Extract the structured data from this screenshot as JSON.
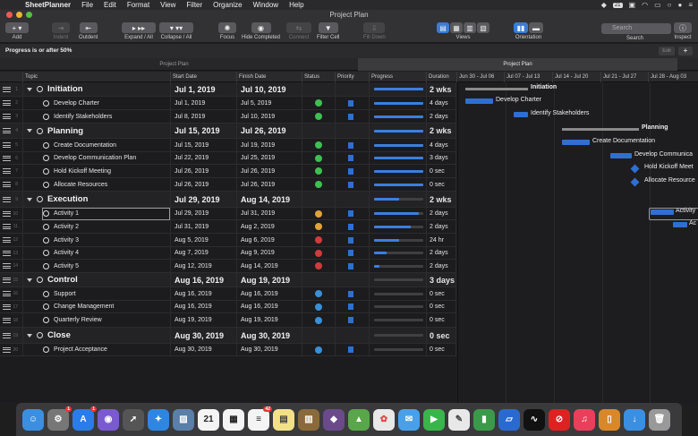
{
  "menubar": {
    "items": [
      "SheetPlanner",
      "File",
      "Edit",
      "Format",
      "View",
      "Filter",
      "Organize",
      "Window",
      "Help"
    ],
    "badge": "21"
  },
  "window": {
    "title": "Project Plan"
  },
  "toolbar": {
    "add": "Add",
    "indent": "Indent",
    "outdent": "Outdent",
    "expand": "Expand / All",
    "collapse": "Collapse / All",
    "focus": "Focus",
    "hide_completed": "Hide Completed",
    "connect": "Connect",
    "filter_cell": "Filter Cell",
    "fill_down": "Fill Down",
    "views": "Views",
    "orientation": "Orientation",
    "search_placeholder": "Search",
    "search_label": "Search",
    "inspect": "Inspect"
  },
  "filterbar": {
    "text": "Progress is or after 50%",
    "edit": "Edit",
    "plus": "+"
  },
  "tabs": {
    "left": "Project Plan",
    "right": "Project Plan"
  },
  "columns": {
    "topic": "Topic",
    "start": "Start Date",
    "finish": "Finish Date",
    "status": "Status",
    "priority": "Priority",
    "progress": "Progress",
    "duration": "Duration"
  },
  "gantt_weeks": [
    "Jun 30 - Jul 06",
    "Jul 07 - Jul 13",
    "Jul 14 - Jul 20",
    "Jul 21 - Jul 27",
    "Jul 28 - Aug 03"
  ],
  "rows": [
    {
      "n": "1",
      "group": true,
      "topic": "Initiation",
      "start": "Jul 1, 2019",
      "finish": "Jul 10, 2019",
      "status": "",
      "progress": 1.0,
      "duration": "2 wks"
    },
    {
      "n": "2",
      "group": false,
      "topic": "Develop Charter",
      "start": "Jul 1, 2019",
      "finish": "Jul 5, 2019",
      "status": "#3fbf52",
      "progress": 1.0,
      "duration": "4 days"
    },
    {
      "n": "3",
      "group": false,
      "topic": "Identify Stakeholders",
      "start": "Jul 8, 2019",
      "finish": "Jul 10, 2019",
      "status": "#3fbf52",
      "progress": 1.0,
      "duration": "2 days"
    },
    {
      "n": "4",
      "group": true,
      "topic": "Planning",
      "start": "Jul 15, 2019",
      "finish": "Jul 26, 2019",
      "status": "",
      "progress": 1.0,
      "duration": "2 wks"
    },
    {
      "n": "5",
      "group": false,
      "topic": "Create Documentation",
      "start": "Jul 15, 2019",
      "finish": "Jul 19, 2019",
      "status": "#3fbf52",
      "progress": 1.0,
      "duration": "4 days"
    },
    {
      "n": "6",
      "group": false,
      "topic": "Develop Communication Plan",
      "start": "Jul 22, 2019",
      "finish": "Jul 25, 2019",
      "status": "#3fbf52",
      "progress": 1.0,
      "duration": "3 days"
    },
    {
      "n": "7",
      "group": false,
      "topic": "Hold Kickoff Meeting",
      "start": "Jul 26, 2019",
      "finish": "Jul 26, 2019",
      "status": "#3fbf52",
      "progress": 1.0,
      "duration": "0 sec"
    },
    {
      "n": "8",
      "group": false,
      "topic": "Allocate Resources",
      "start": "Jul 26, 2019",
      "finish": "Jul 26, 2019",
      "status": "#3fbf52",
      "progress": 1.0,
      "duration": "0 sec"
    },
    {
      "n": "9",
      "group": true,
      "topic": "Execution",
      "start": "Jul 29, 2019",
      "finish": "Aug 14, 2019",
      "status": "",
      "progress": 0.5,
      "duration": "2 wks"
    },
    {
      "n": "10",
      "group": false,
      "topic": "Activity 1",
      "start": "Jul 29, 2019",
      "finish": "Jul 31, 2019",
      "status": "#e0a33a",
      "progress": 0.9,
      "duration": "2 days"
    },
    {
      "n": "11",
      "group": false,
      "topic": "Activity 2",
      "start": "Jul 31, 2019",
      "finish": "Aug 2, 2019",
      "status": "#e0a33a",
      "progress": 0.75,
      "duration": "2 days"
    },
    {
      "n": "12",
      "group": false,
      "topic": "Activity 3",
      "start": "Aug 5, 2019",
      "finish": "Aug 6, 2019",
      "status": "#d13b3b",
      "progress": 0.5,
      "duration": "24 hr"
    },
    {
      "n": "13",
      "group": false,
      "topic": "Activity 4",
      "start": "Aug 7, 2019",
      "finish": "Aug 9, 2019",
      "status": "#d13b3b",
      "progress": 0.25,
      "duration": "2 days"
    },
    {
      "n": "14",
      "group": false,
      "topic": "Activity 5",
      "start": "Aug 12, 2019",
      "finish": "Aug 14, 2019",
      "status": "#d13b3b",
      "progress": 0.1,
      "duration": "2 days"
    },
    {
      "n": "15",
      "group": true,
      "topic": "Control",
      "start": "Aug 16, 2019",
      "finish": "Aug 19, 2019",
      "status": "",
      "progress": 0.0,
      "duration": "3 days"
    },
    {
      "n": "16",
      "group": false,
      "topic": "Support",
      "start": "Aug 16, 2019",
      "finish": "Aug 16, 2019",
      "status": "#3a8fd6",
      "progress": 0.0,
      "duration": "0 sec"
    },
    {
      "n": "17",
      "group": false,
      "topic": "Change Management",
      "start": "Aug 16, 2019",
      "finish": "Aug 16, 2019",
      "status": "#3a8fd6",
      "progress": 0.0,
      "duration": "0 sec"
    },
    {
      "n": "18",
      "group": false,
      "topic": "Quarterly Review",
      "start": "Aug 19, 2019",
      "finish": "Aug 19, 2019",
      "status": "#3a8fd6",
      "progress": 0.0,
      "duration": "0 sec"
    },
    {
      "n": "19",
      "group": true,
      "topic": "Close",
      "start": "Aug 30, 2019",
      "finish": "Aug 30, 2019",
      "status": "",
      "progress": 0.0,
      "duration": "0 sec"
    },
    {
      "n": "20",
      "group": false,
      "topic": "Project Acceptance",
      "start": "Aug 30, 2019",
      "finish": "Aug 30, 2019",
      "status": "#3a8fd6",
      "progress": 0.0,
      "duration": "0 sec"
    }
  ],
  "gantt_labels": [
    "Initiation",
    "Develop Charter",
    "Identify Stakeholders",
    "Planning",
    "Create Documentation",
    "Develop Communica",
    "Hold Kickoff Meet",
    "Allocate Resource",
    "Activity",
    "Ac"
  ],
  "dock_badges": {
    "settings": "1",
    "appstore": "1",
    "calendar": "21",
    "reminders": "42"
  }
}
